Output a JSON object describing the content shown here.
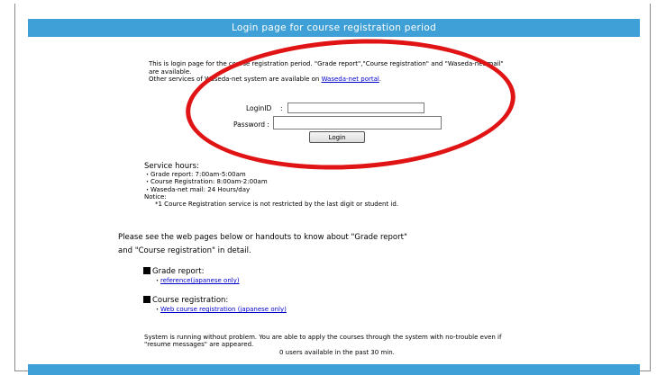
{
  "header": {
    "title": "Login page for course registration period"
  },
  "intro": {
    "line1": "This is login page for the course registration period. \"Grade report\",\"Course registration\" and \"Waseda-net mail\"",
    "line2": "are available.",
    "line3_prefix": "Other services of Waseda-net system are available on ",
    "portal_link": "Waseda-net portal",
    "line3_suffix": "."
  },
  "login": {
    "loginid_label": "LoginID",
    "loginid_sep": ":",
    "loginid_value": "",
    "password_label": "Password :",
    "password_value": "",
    "button_label": "Login"
  },
  "service": {
    "heading": "Service hours:",
    "items": [
      "・Grade report: 7:00am-5:00am",
      "・Course Registration: 8:00am-2:00am",
      "・Waseda-net mail: 24 Hours/day"
    ],
    "notice_label": "Notice:",
    "notice_text": "*1 Cource Registration service is not restricted by the last digit or student id."
  },
  "info": {
    "line1": "Please see the web pages below or handouts to know about \"Grade report\"",
    "line2": "and \"Course registration\" in detail."
  },
  "sections": {
    "grade": {
      "title": "Grade report:",
      "link": "reference(japanese only)",
      "bullet": "・"
    },
    "course": {
      "title": "Course registration:",
      "link": "Web course registration (japanese only)",
      "bullet": "・"
    }
  },
  "status": {
    "line1": "System is running without problem. You are able to apply the courses through the system with no-trouble even if",
    "line2": "\"resume messages\" are appeared.",
    "users": "0 users available in the past 30 min."
  },
  "colors": {
    "header_bg": "#3fa0d8",
    "annotation": "#e01414",
    "link": "#0000cc"
  }
}
